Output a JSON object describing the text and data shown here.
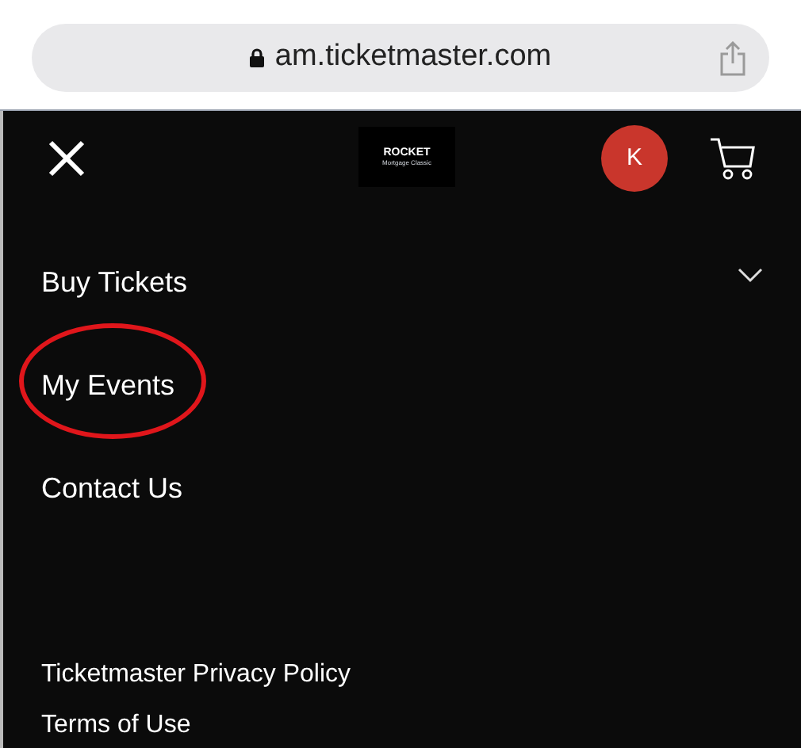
{
  "browser": {
    "url": "am.ticketmaster.com"
  },
  "header": {
    "logo": {
      "line_1": "ROCKET",
      "line_2": "Mortgage Classic"
    },
    "avatar": "K"
  },
  "menu": [
    {
      "label": "Buy Tickets",
      "kind": "expandable",
      "expanded": false,
      "circled": false
    },
    {
      "label": "My Events",
      "kind": "link",
      "circled": true
    },
    {
      "label": "Contact Us",
      "kind": "link",
      "circled": false
    }
  ],
  "footer_links": [
    "Ticketmaster Privacy Policy",
    "Terms of Use"
  ]
}
